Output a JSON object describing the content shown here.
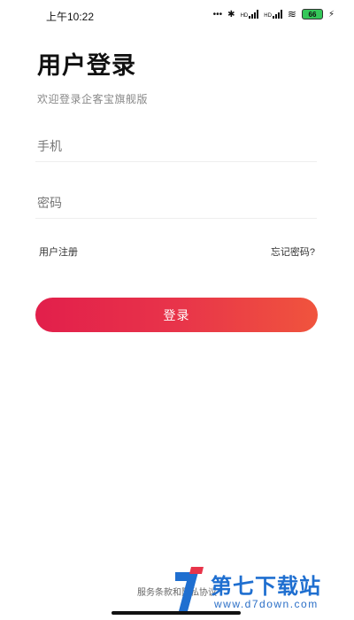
{
  "status_bar": {
    "time": "上午10:22",
    "dots": "•••",
    "bluetooth": "✱",
    "signal1": "HD",
    "signal2": "HD",
    "wifi": "≋",
    "battery_level": "66",
    "charging": "⚡"
  },
  "login": {
    "title": "用户登录",
    "subtitle": "欢迎登录企客宝旗舰版",
    "phone_placeholder": "手机",
    "password_placeholder": "密码",
    "register_link": "用户注册",
    "forgot_link": "忘记密码?",
    "login_button": "登录"
  },
  "footer": {
    "terms": "服务条款和隐私协议"
  },
  "watermark": {
    "name": "第七下载站",
    "url": "www.d7down.com"
  },
  "colors": {
    "button_gradient_start": "#e21f4b",
    "button_gradient_end": "#f0543d",
    "watermark_blue": "#1f6fd0"
  }
}
